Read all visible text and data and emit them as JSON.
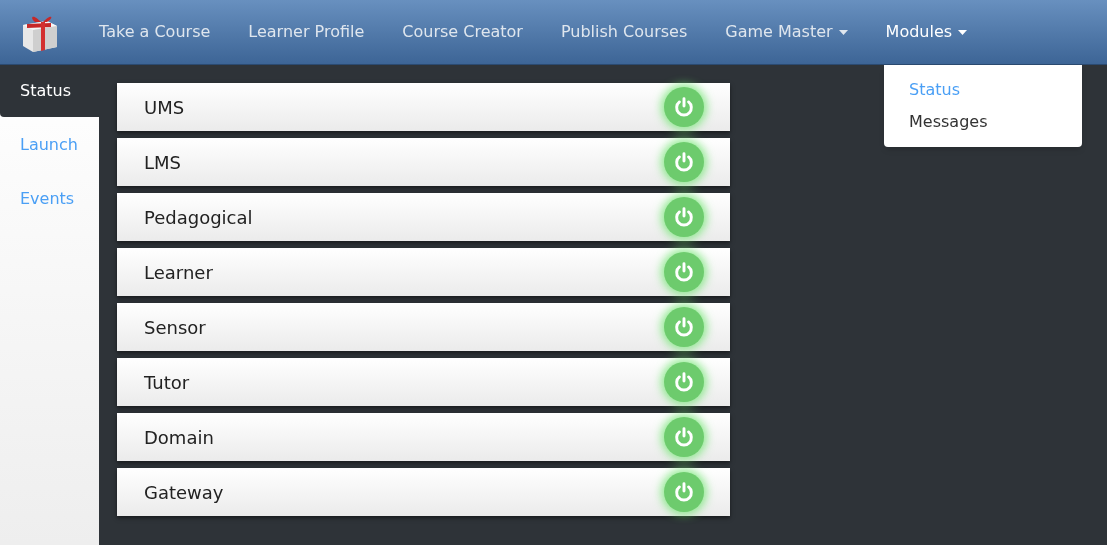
{
  "navbar": {
    "items": [
      {
        "label": "Take a Course",
        "has_menu": false,
        "open": false
      },
      {
        "label": "Learner Profile",
        "has_menu": false,
        "open": false
      },
      {
        "label": "Course Creator",
        "has_menu": false,
        "open": false
      },
      {
        "label": "Publish Courses",
        "has_menu": false,
        "open": false
      },
      {
        "label": "Game Master",
        "has_menu": true,
        "open": false
      },
      {
        "label": "Modules",
        "has_menu": true,
        "open": true
      }
    ]
  },
  "dropdown": {
    "items": [
      {
        "label": "Status",
        "selected": true
      },
      {
        "label": "Messages",
        "selected": false
      }
    ]
  },
  "sidebar": {
    "tabs": [
      {
        "label": "Status",
        "selected": true
      },
      {
        "label": "Launch",
        "selected": false
      },
      {
        "label": "Events",
        "selected": false
      }
    ]
  },
  "modules": [
    {
      "name": "UMS",
      "on": true
    },
    {
      "name": "LMS",
      "on": true
    },
    {
      "name": "Pedagogical",
      "on": true
    },
    {
      "name": "Learner",
      "on": true
    },
    {
      "name": "Sensor",
      "on": true
    },
    {
      "name": "Tutor",
      "on": true
    },
    {
      "name": "Domain",
      "on": true
    },
    {
      "name": "Gateway",
      "on": true
    }
  ]
}
